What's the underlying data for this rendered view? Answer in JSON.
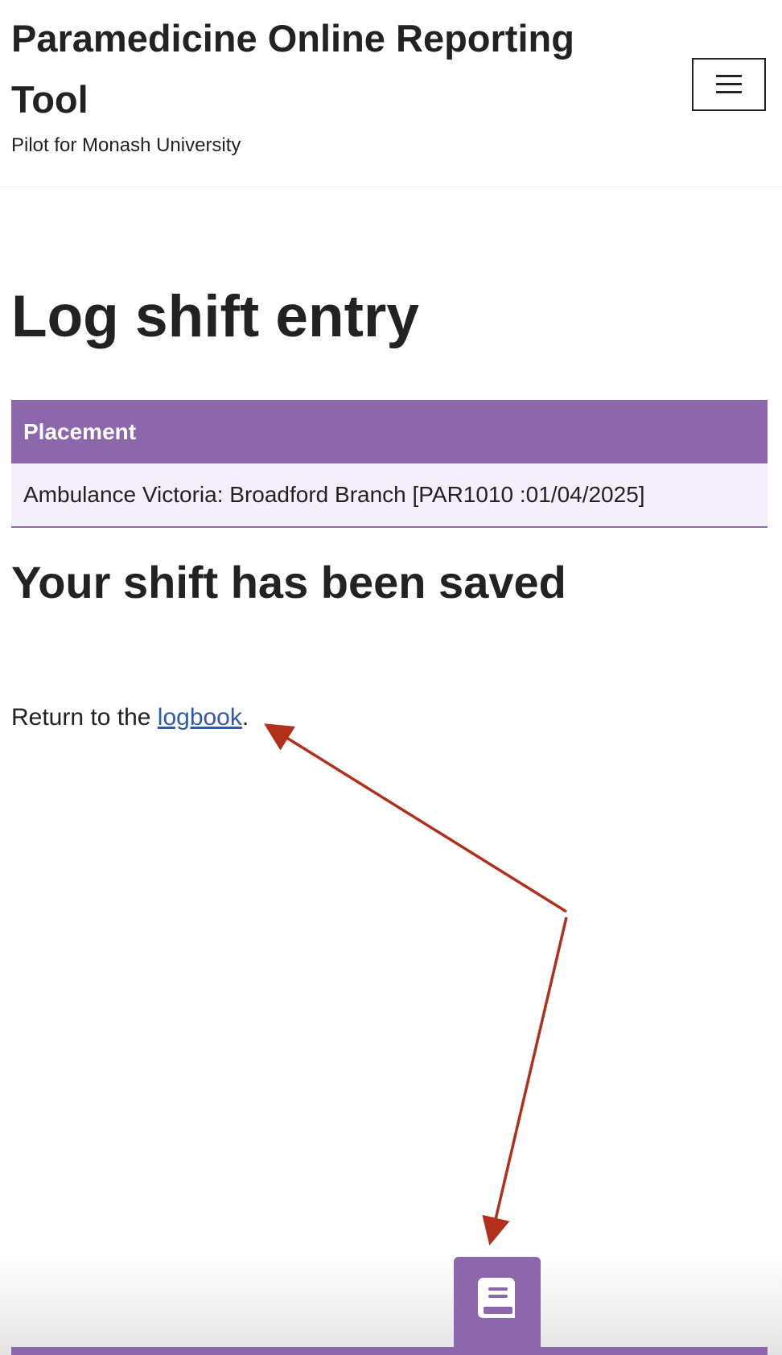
{
  "header": {
    "site_title": "Paramedicine Online Reporting Tool",
    "tagline": "Pilot for Monash University",
    "menu_icon": "hamburger-menu-icon"
  },
  "main": {
    "page_title": "Log shift entry",
    "placement_table": {
      "header": "Placement",
      "value": "Ambulance Victoria: Broadford Branch [PAR1010 :01/04/2025]"
    },
    "saved_heading": "Your shift has been saved",
    "return_prefix": "Return to the ",
    "logbook_link": "logbook",
    "return_suffix": "."
  },
  "footer_nav": {
    "logbook_icon": "book-icon"
  },
  "colors": {
    "accent": "#8c67ab",
    "row_background": "#f5eefb",
    "link": "#2f5aa8",
    "annotation_arrow": "#b0301c"
  }
}
